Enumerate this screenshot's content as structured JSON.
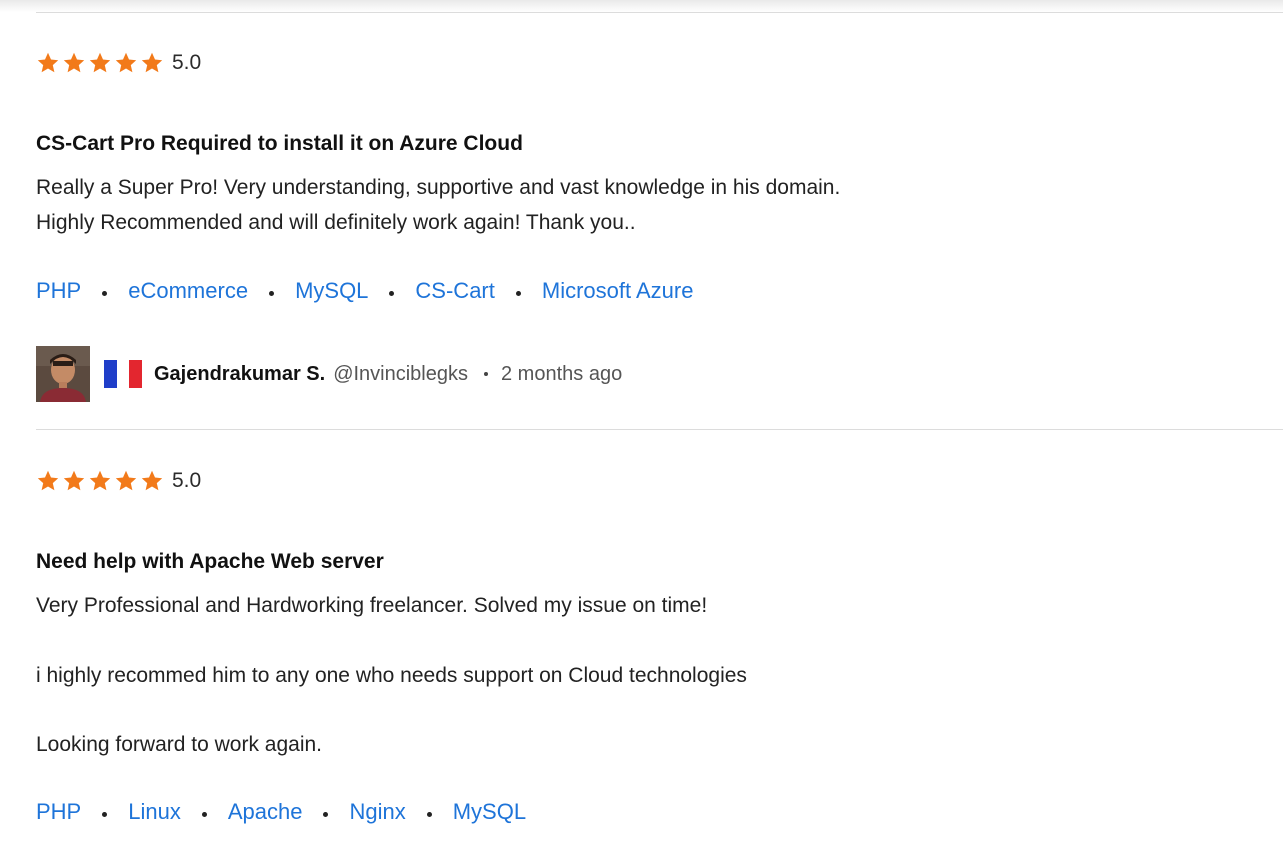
{
  "reviews": [
    {
      "score": "5.0",
      "stars": 5,
      "title": "CS-Cart Pro Required to install it on Azure Cloud",
      "paragraphs": [
        "Really a Super Pro! Very understanding, supportive and vast knowledge in his domain.",
        "Highly Recommended and will definitely work again! Thank you.."
      ],
      "tags": [
        "PHP",
        "eCommerce",
        "MySQL",
        "CS-Cart",
        "Microsoft Azure"
      ],
      "author": {
        "name": "Gajendrakumar S.",
        "handle": "@Invinciblegks",
        "time": "2 months ago",
        "flag_icon": "france-flag-icon",
        "avatar_icon": "user-avatar"
      }
    },
    {
      "score": "5.0",
      "stars": 5,
      "title": "Need help with Apache Web server",
      "paragraphs": [
        "Very Professional and Hardworking freelancer. Solved my issue on time!",
        "i highly recommed him to any one who needs support on Cloud technologies",
        "Looking forward to work again."
      ],
      "tags": [
        "PHP",
        "Linux",
        "Apache",
        "Nginx",
        "MySQL"
      ]
    }
  ],
  "colors": {
    "star": "#f27a1a",
    "tag_link": "#1e74d9",
    "flag_blue": "#1f3ec9",
    "flag_white": "#ffffff",
    "flag_red": "#e3262f"
  }
}
